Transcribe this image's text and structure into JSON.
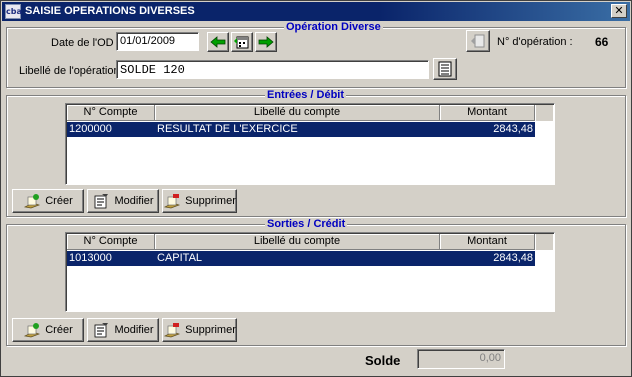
{
  "window": {
    "app_icon_text": "cba",
    "title": "SAISIE OPERATIONS DIVERSES",
    "close_glyph": "✕"
  },
  "operation": {
    "group_title": "Opération Diverse",
    "date_label": "Date de l'OD",
    "date_value": "01/01/2009",
    "libelle_label": "Libellé de l'opération",
    "libelle_value": "SOLDE 120",
    "numero_label": "N° d'opération :",
    "numero_value": "66"
  },
  "entrees": {
    "group_title": "Entrées / Débit",
    "columns": [
      "N° Compte",
      "Libellé du compte",
      "Montant"
    ],
    "rows": [
      {
        "compte": "1200000",
        "libelle": "RESULTAT DE L'EXERCICE",
        "montant": "2843,48",
        "selected": true
      }
    ],
    "buttons": {
      "create": "Créer",
      "edit": "Modifier",
      "delete": "Supprimer"
    }
  },
  "sorties": {
    "group_title": "Sorties / Crédit",
    "columns": [
      "N° Compte",
      "Libellé du compte",
      "Montant"
    ],
    "rows": [
      {
        "compte": "1013000",
        "libelle": "CAPITAL",
        "montant": "2843,48",
        "selected": true
      }
    ],
    "buttons": {
      "create": "Créer",
      "edit": "Modifier",
      "delete": "Supprimer"
    }
  },
  "solde": {
    "label": "Solde",
    "value": "0,00"
  },
  "colors": {
    "title_bar": "#0a246a",
    "group_title": "#0000c0",
    "selection": "#0a246a",
    "nav_arrow": "#00a000",
    "window_bg": "#d4d0c8"
  }
}
